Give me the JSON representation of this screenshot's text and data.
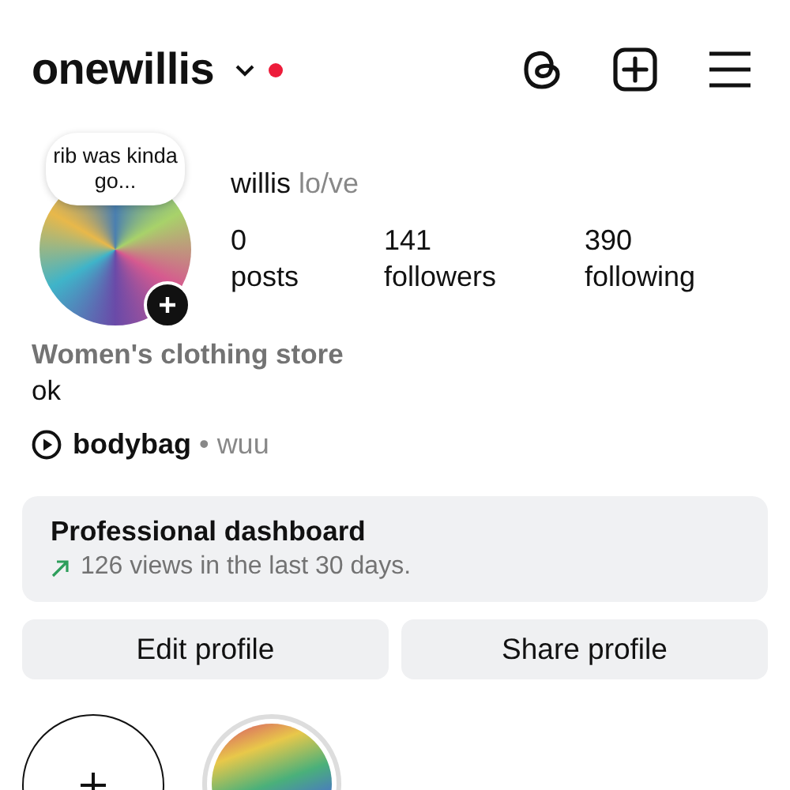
{
  "header": {
    "username": "onewillis",
    "has_notification": true
  },
  "profile": {
    "note": "rib was kinda go...",
    "name": "willis",
    "pronouns": "lo/ve",
    "stats": [
      {
        "value": "0",
        "label": "posts"
      },
      {
        "value": "141",
        "label": "followers"
      },
      {
        "value": "390",
        "label": "following"
      }
    ]
  },
  "category": "Women's clothing store",
  "bio": "ok",
  "music": {
    "track": "bodybag",
    "separator": "•",
    "artist": "wuu"
  },
  "dashboard": {
    "title": "Professional dashboard",
    "stat": "126 views in the last 30 days."
  },
  "buttons": [
    "Edit profile",
    "Share profile"
  ],
  "highlights": [
    {
      "kind": "new"
    },
    {
      "kind": "photo"
    }
  ]
}
